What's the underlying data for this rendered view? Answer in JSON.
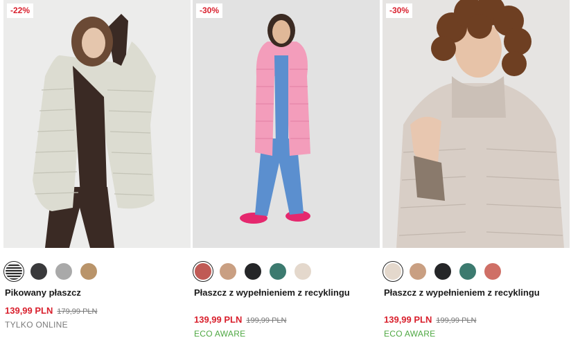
{
  "products": [
    {
      "discount": "-22%",
      "name": "Pikowany płaszcz",
      "price": "139,99 PLN",
      "old_price": "179,99 PLN",
      "tag": "TYLKO ONLINE",
      "swatches": [
        "#e6e6e6",
        "#3a3a3c",
        "#a9a9a9",
        "#b9946a"
      ]
    },
    {
      "discount": "-30%",
      "name": "Płaszcz z wypełnieniem z recyklingu",
      "price": "139,99 PLN",
      "old_price": "199,99 PLN",
      "tag": "ECO AWARE",
      "swatches": [
        "#c05a55",
        "#c99f82",
        "#252628",
        "#3c7a6f",
        "#e4d8cc"
      ]
    },
    {
      "discount": "-30%",
      "name": "Płaszcz z wypełnieniem z recyklingu",
      "price": "139,99 PLN",
      "old_price": "199,99 PLN",
      "tag": "ECO AWARE",
      "swatches": [
        "#e4d8cc",
        "#c99f82",
        "#252628",
        "#3c7a6f",
        "#cf6f66"
      ]
    }
  ],
  "colors": {
    "sale_red": "#d9202d",
    "eco_green": "#4fa843"
  }
}
